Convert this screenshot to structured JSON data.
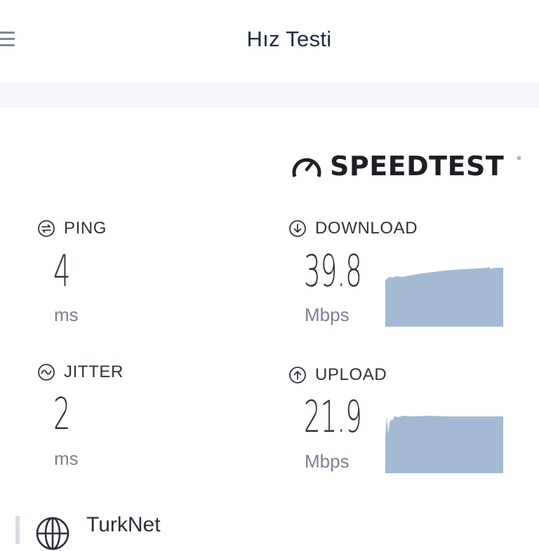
{
  "header": {
    "title": "Hız Testi"
  },
  "brand": {
    "name": "SPEEDTEST",
    "mark": "®"
  },
  "ping": {
    "label": "PING",
    "value": "4",
    "unit": "ms",
    "icon": "ping-icon"
  },
  "jitter": {
    "label": "JITTER",
    "value": "2",
    "unit": "ms",
    "icon": "jitter-icon"
  },
  "download": {
    "label": "DOWNLOAD",
    "value": "39.8",
    "unit": "Mbps",
    "icon": "download-arrow-icon"
  },
  "upload": {
    "label": "UPLOAD",
    "value": "21.9",
    "unit": "Mbps",
    "icon": "upload-arrow-icon"
  },
  "isp": {
    "name": "TurkNet",
    "icon": "globe-icon"
  },
  "colors": {
    "graph_fill": "#a3b9d3",
    "title_text": "#1f2a44",
    "title_band": "#f4f6f9",
    "label_text": "#2f323c",
    "unit_text": "#7c8190"
  }
}
